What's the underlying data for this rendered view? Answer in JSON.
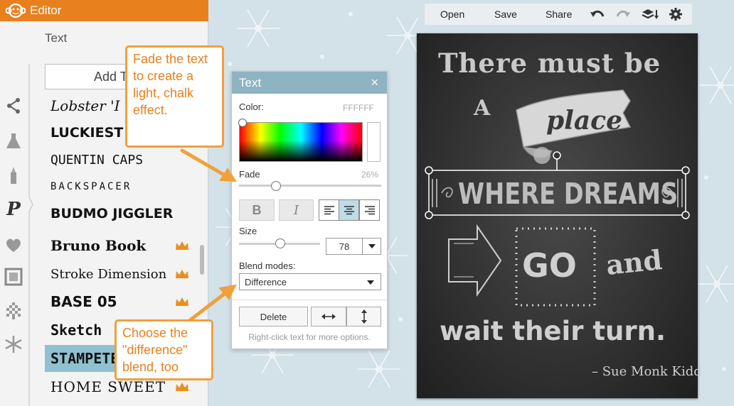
{
  "app": {
    "title": "Editor"
  },
  "sidebar": {
    "panel_title": "Text",
    "add_text_label": "Add T",
    "rail_icons": [
      "effects-icon",
      "lab-icon",
      "touch-up-icon",
      "text-icon",
      "stickers-icon",
      "frames-icon",
      "textures-icon",
      "themes-icon"
    ],
    "fonts": [
      {
        "label": "Lobster 'I wo",
        "premium": false
      },
      {
        "label": "LUCKIEST G",
        "premium": false
      },
      {
        "label": "QUENTIN CAPS",
        "premium": false
      },
      {
        "label": "BACKSPACER",
        "premium": false
      },
      {
        "label": "BUDMO JIGGLER",
        "premium": false
      },
      {
        "label": "Bruno Book",
        "premium": true
      },
      {
        "label": "Stroke Dimension",
        "premium": true
      },
      {
        "label": "BASE 05",
        "premium": true
      },
      {
        "label": "Sketch",
        "premium": false
      },
      {
        "label": "STAMPETE",
        "premium": false,
        "selected": true
      },
      {
        "label": "HOME SWEET",
        "premium": true
      }
    ]
  },
  "toolbar": {
    "open_label": "Open",
    "save_label": "Save",
    "share_label": "Share"
  },
  "poster": {
    "line1": "There must be",
    "line2a": "A",
    "line2b": "place",
    "line3": "WHERE DREAMS",
    "line4a": "GO",
    "line4b": "and",
    "line5": "wait their turn.",
    "attribution": "– Sue Monk Kidd"
  },
  "text_dialog": {
    "title": "Text",
    "close_glyph": "×",
    "color_label": "Color:",
    "color_value": "FFFFFF",
    "fade_label": "Fade",
    "fade_value": "26%",
    "fade_fraction": 0.26,
    "bold_label": "B",
    "italic_label": "I",
    "size_label": "Size",
    "size_value": "78",
    "blend_label": "Blend modes:",
    "blend_value": "Difference",
    "delete_label": "Delete",
    "hint": "Right-click text for more options."
  },
  "callouts": {
    "fade_tip": "Fade the text to create a light, chalk effect.",
    "blend_tip": "Choose the \"difference\" blend, too"
  },
  "colors": {
    "brand_orange": "#e8801e",
    "dialog_header": "#8eb3c1",
    "selected_font": "#8fc1d0",
    "callout_border": "#f0a03a"
  }
}
